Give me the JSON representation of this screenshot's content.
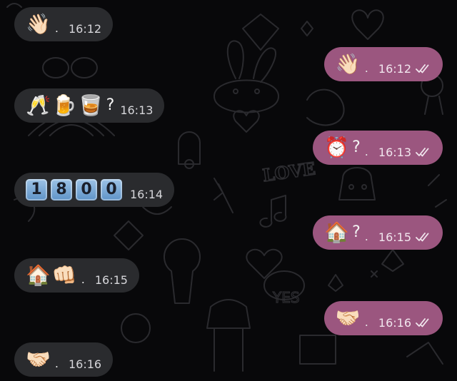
{
  "messages": [
    {
      "side": "in",
      "emojis": [
        "👋🏻"
      ],
      "suffix": "",
      "time": "16:12",
      "dot": true
    },
    {
      "side": "out",
      "emojis": [
        "👋🏻"
      ],
      "suffix": "",
      "time": "16:12",
      "dot": true,
      "read": true
    },
    {
      "side": "in",
      "emojis": [
        "🥂",
        "🍺",
        "🥃"
      ],
      "suffix": "?",
      "time": "16:13",
      "dot": false
    },
    {
      "side": "out",
      "emojis": [
        "⏰"
      ],
      "suffix": "?",
      "time": "16:13",
      "dot": true,
      "read": true
    },
    {
      "side": "in",
      "digits": [
        "1",
        "8",
        "0",
        "0"
      ],
      "time": "16:14"
    },
    {
      "side": "out",
      "emojis": [
        "🏠"
      ],
      "suffix": "?",
      "time": "16:15",
      "dot": true,
      "read": true
    },
    {
      "side": "in",
      "emojis": [
        "🏠",
        "👊🏻"
      ],
      "suffix": "",
      "time": "16:15",
      "dot": true
    },
    {
      "side": "out",
      "emojis": [
        "🤝🏻"
      ],
      "suffix": "",
      "time": "16:16",
      "dot": true,
      "read": true
    },
    {
      "side": "in",
      "emojis": [
        "🤝🏻"
      ],
      "suffix": "",
      "time": "16:16",
      "dot": true
    }
  ],
  "wallpaper_text": [
    "LOVE",
    "YES"
  ],
  "colors": {
    "background": "#08080a",
    "incoming_bubble": "#2a2b2e",
    "outgoing_bubble": "#9b567f",
    "digit_key": "#7aaede"
  }
}
